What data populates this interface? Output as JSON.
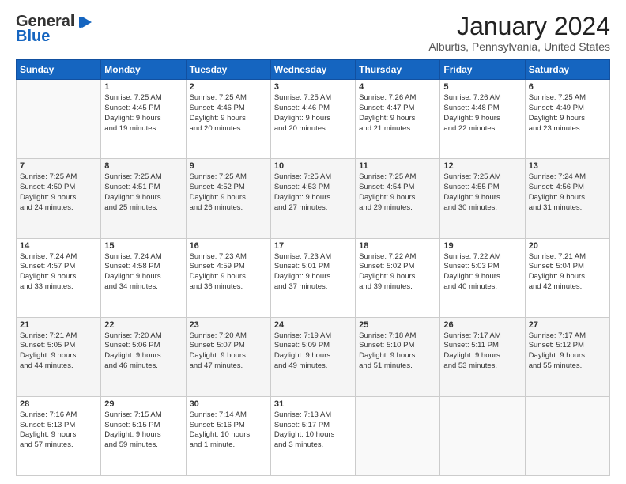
{
  "header": {
    "logo_line1": "General",
    "logo_line2": "Blue",
    "title": "January 2024",
    "subtitle": "Alburtis, Pennsylvania, United States"
  },
  "calendar": {
    "days_of_week": [
      "Sunday",
      "Monday",
      "Tuesday",
      "Wednesday",
      "Thursday",
      "Friday",
      "Saturday"
    ],
    "weeks": [
      [
        {
          "day": "",
          "info": ""
        },
        {
          "day": "1",
          "info": "Sunrise: 7:25 AM\nSunset: 4:45 PM\nDaylight: 9 hours\nand 19 minutes."
        },
        {
          "day": "2",
          "info": "Sunrise: 7:25 AM\nSunset: 4:46 PM\nDaylight: 9 hours\nand 20 minutes."
        },
        {
          "day": "3",
          "info": "Sunrise: 7:25 AM\nSunset: 4:46 PM\nDaylight: 9 hours\nand 20 minutes."
        },
        {
          "day": "4",
          "info": "Sunrise: 7:26 AM\nSunset: 4:47 PM\nDaylight: 9 hours\nand 21 minutes."
        },
        {
          "day": "5",
          "info": "Sunrise: 7:26 AM\nSunset: 4:48 PM\nDaylight: 9 hours\nand 22 minutes."
        },
        {
          "day": "6",
          "info": "Sunrise: 7:25 AM\nSunset: 4:49 PM\nDaylight: 9 hours\nand 23 minutes."
        }
      ],
      [
        {
          "day": "7",
          "info": "Sunrise: 7:25 AM\nSunset: 4:50 PM\nDaylight: 9 hours\nand 24 minutes."
        },
        {
          "day": "8",
          "info": "Sunrise: 7:25 AM\nSunset: 4:51 PM\nDaylight: 9 hours\nand 25 minutes."
        },
        {
          "day": "9",
          "info": "Sunrise: 7:25 AM\nSunset: 4:52 PM\nDaylight: 9 hours\nand 26 minutes."
        },
        {
          "day": "10",
          "info": "Sunrise: 7:25 AM\nSunset: 4:53 PM\nDaylight: 9 hours\nand 27 minutes."
        },
        {
          "day": "11",
          "info": "Sunrise: 7:25 AM\nSunset: 4:54 PM\nDaylight: 9 hours\nand 29 minutes."
        },
        {
          "day": "12",
          "info": "Sunrise: 7:25 AM\nSunset: 4:55 PM\nDaylight: 9 hours\nand 30 minutes."
        },
        {
          "day": "13",
          "info": "Sunrise: 7:24 AM\nSunset: 4:56 PM\nDaylight: 9 hours\nand 31 minutes."
        }
      ],
      [
        {
          "day": "14",
          "info": "Sunrise: 7:24 AM\nSunset: 4:57 PM\nDaylight: 9 hours\nand 33 minutes."
        },
        {
          "day": "15",
          "info": "Sunrise: 7:24 AM\nSunset: 4:58 PM\nDaylight: 9 hours\nand 34 minutes."
        },
        {
          "day": "16",
          "info": "Sunrise: 7:23 AM\nSunset: 4:59 PM\nDaylight: 9 hours\nand 36 minutes."
        },
        {
          "day": "17",
          "info": "Sunrise: 7:23 AM\nSunset: 5:01 PM\nDaylight: 9 hours\nand 37 minutes."
        },
        {
          "day": "18",
          "info": "Sunrise: 7:22 AM\nSunset: 5:02 PM\nDaylight: 9 hours\nand 39 minutes."
        },
        {
          "day": "19",
          "info": "Sunrise: 7:22 AM\nSunset: 5:03 PM\nDaylight: 9 hours\nand 40 minutes."
        },
        {
          "day": "20",
          "info": "Sunrise: 7:21 AM\nSunset: 5:04 PM\nDaylight: 9 hours\nand 42 minutes."
        }
      ],
      [
        {
          "day": "21",
          "info": "Sunrise: 7:21 AM\nSunset: 5:05 PM\nDaylight: 9 hours\nand 44 minutes."
        },
        {
          "day": "22",
          "info": "Sunrise: 7:20 AM\nSunset: 5:06 PM\nDaylight: 9 hours\nand 46 minutes."
        },
        {
          "day": "23",
          "info": "Sunrise: 7:20 AM\nSunset: 5:07 PM\nDaylight: 9 hours\nand 47 minutes."
        },
        {
          "day": "24",
          "info": "Sunrise: 7:19 AM\nSunset: 5:09 PM\nDaylight: 9 hours\nand 49 minutes."
        },
        {
          "day": "25",
          "info": "Sunrise: 7:18 AM\nSunset: 5:10 PM\nDaylight: 9 hours\nand 51 minutes."
        },
        {
          "day": "26",
          "info": "Sunrise: 7:17 AM\nSunset: 5:11 PM\nDaylight: 9 hours\nand 53 minutes."
        },
        {
          "day": "27",
          "info": "Sunrise: 7:17 AM\nSunset: 5:12 PM\nDaylight: 9 hours\nand 55 minutes."
        }
      ],
      [
        {
          "day": "28",
          "info": "Sunrise: 7:16 AM\nSunset: 5:13 PM\nDaylight: 9 hours\nand 57 minutes."
        },
        {
          "day": "29",
          "info": "Sunrise: 7:15 AM\nSunset: 5:15 PM\nDaylight: 9 hours\nand 59 minutes."
        },
        {
          "day": "30",
          "info": "Sunrise: 7:14 AM\nSunset: 5:16 PM\nDaylight: 10 hours\nand 1 minute."
        },
        {
          "day": "31",
          "info": "Sunrise: 7:13 AM\nSunset: 5:17 PM\nDaylight: 10 hours\nand 3 minutes."
        },
        {
          "day": "",
          "info": ""
        },
        {
          "day": "",
          "info": ""
        },
        {
          "day": "",
          "info": ""
        }
      ]
    ]
  }
}
